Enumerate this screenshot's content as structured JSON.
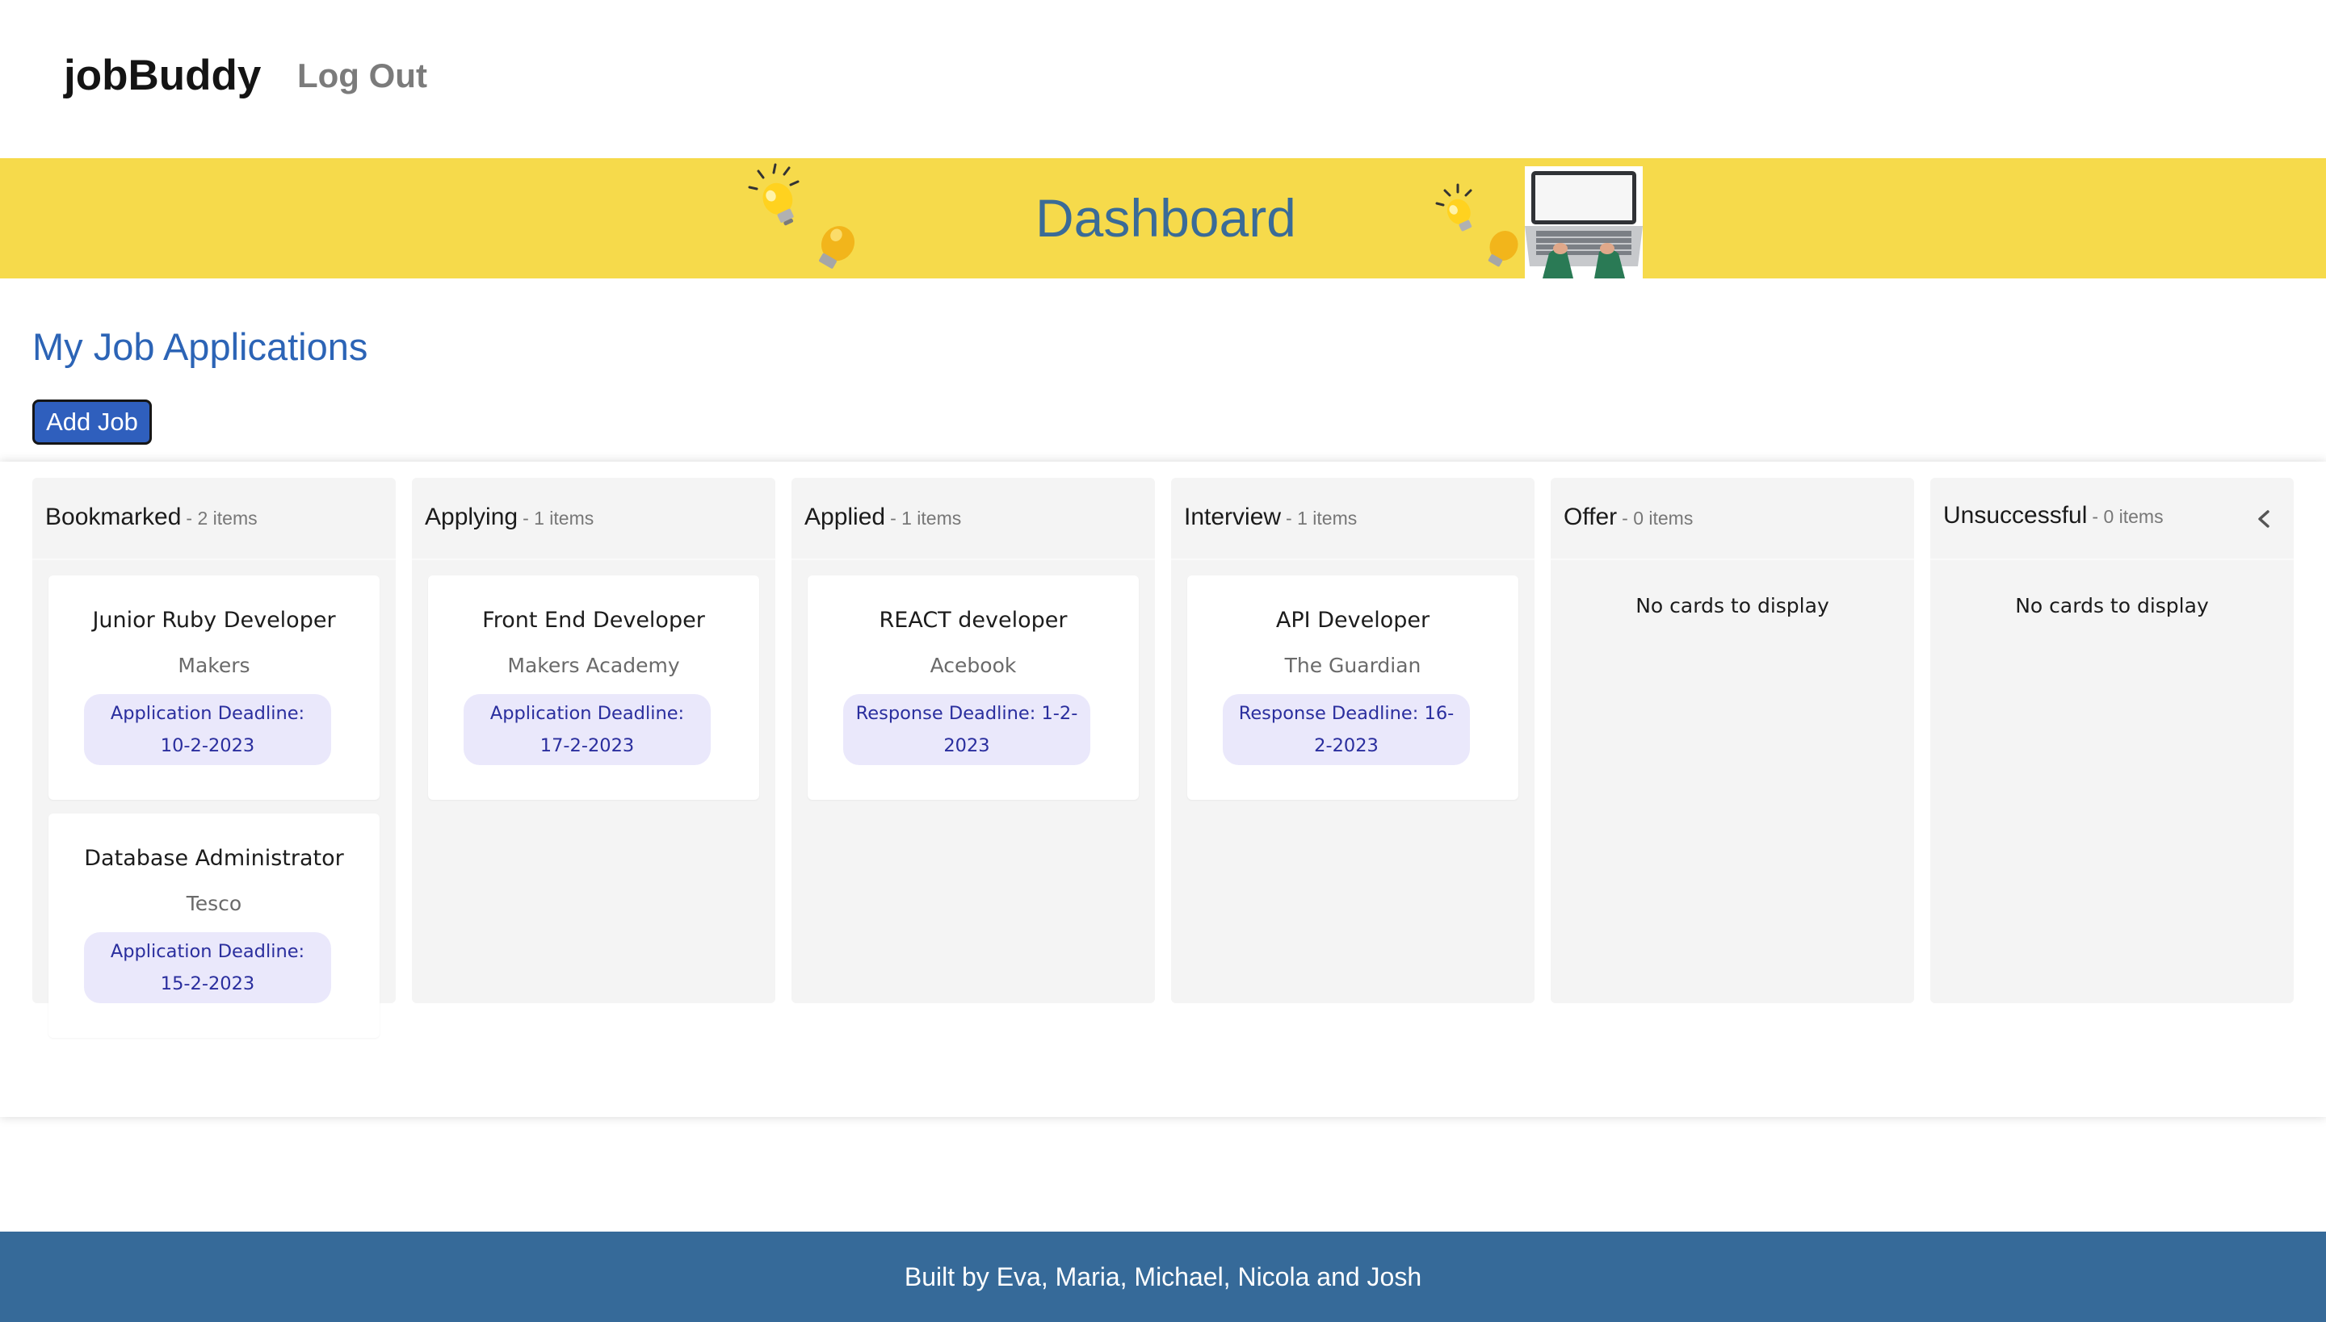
{
  "header": {
    "brand": "jobBuddy",
    "logout_label": "Log Out"
  },
  "banner": {
    "title": "Dashboard",
    "accent_color": "#f6da4b",
    "icons": [
      "lightbulb-icon",
      "laptop-icon"
    ]
  },
  "main": {
    "heading": "My Job Applications",
    "add_button_label": "Add Job",
    "lanes": [
      {
        "title": "Bookmarked",
        "count": "- 2 items",
        "cards": [
          {
            "title": "Junior Ruby Developer",
            "company": "Makers",
            "deadline": "Application Deadline: 10-2-2023"
          },
          {
            "title": "Database Administrator",
            "company": "Tesco",
            "deadline": "Application Deadline: 15-2-2023"
          }
        ]
      },
      {
        "title": "Applying",
        "count": "- 1 items",
        "cards": [
          {
            "title": "Front End Developer",
            "company": "Makers Academy",
            "deadline": "Application Deadline: 17-2-2023"
          }
        ]
      },
      {
        "title": "Applied",
        "count": "- 1 items",
        "cards": [
          {
            "title": "REACT developer",
            "company": "Acebook",
            "deadline": "Response Deadline: 1-2-2023"
          }
        ]
      },
      {
        "title": "Interview",
        "count": "- 1 items",
        "cards": [
          {
            "title": "API Developer",
            "company": "The Guardian",
            "deadline": "Response Deadline: 16-2-2023"
          }
        ]
      },
      {
        "title": "Offer",
        "count": "- 0 items",
        "empty_text": "No cards to display"
      },
      {
        "title": "Unsuccessful",
        "count": "- 0 items",
        "empty_text": "No cards to display"
      }
    ]
  },
  "footer": {
    "text": "Built by Eva, Maria, Michael, Nicola and Josh",
    "color": "#366a99"
  }
}
